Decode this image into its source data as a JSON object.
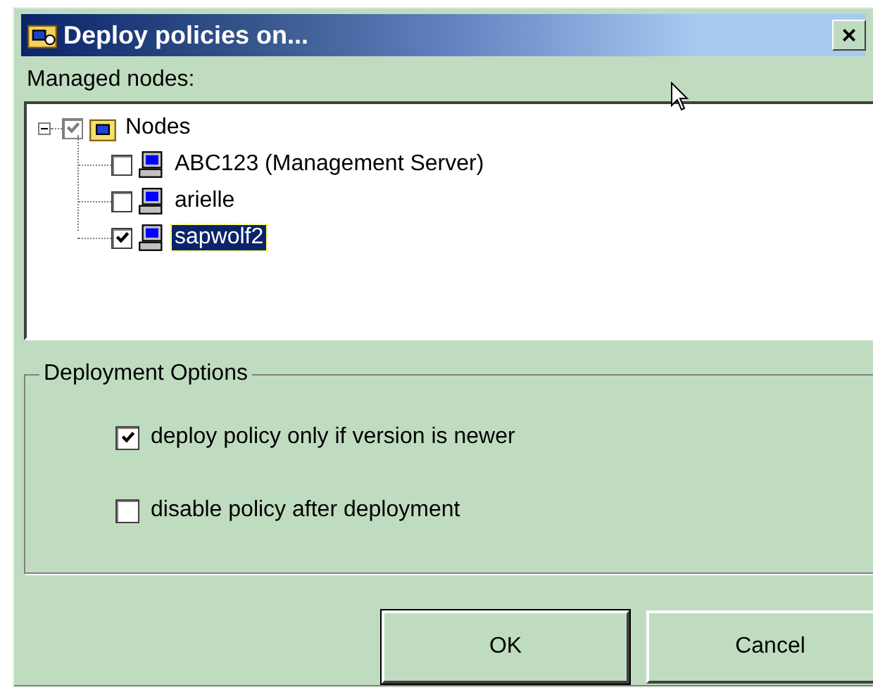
{
  "window": {
    "title": "Deploy policies on...",
    "close_glyph": "×"
  },
  "tree": {
    "label": "Managed nodes:",
    "root": {
      "label": "Nodes",
      "expanded": true,
      "checked": true,
      "grayed": true,
      "selected": false,
      "children": [
        {
          "label": "ABC123 (Management Server)",
          "checked": false,
          "selected": false
        },
        {
          "label": "arielle",
          "checked": false,
          "selected": false
        },
        {
          "label": "sapwolf2",
          "checked": true,
          "selected": true
        }
      ]
    }
  },
  "options": {
    "title": "Deployment Options",
    "items": [
      {
        "label": "deploy policy only if version is newer",
        "checked": true
      },
      {
        "label": "disable policy after deployment",
        "checked": false
      }
    ]
  },
  "buttons": [
    "OK",
    "Cancel"
  ]
}
